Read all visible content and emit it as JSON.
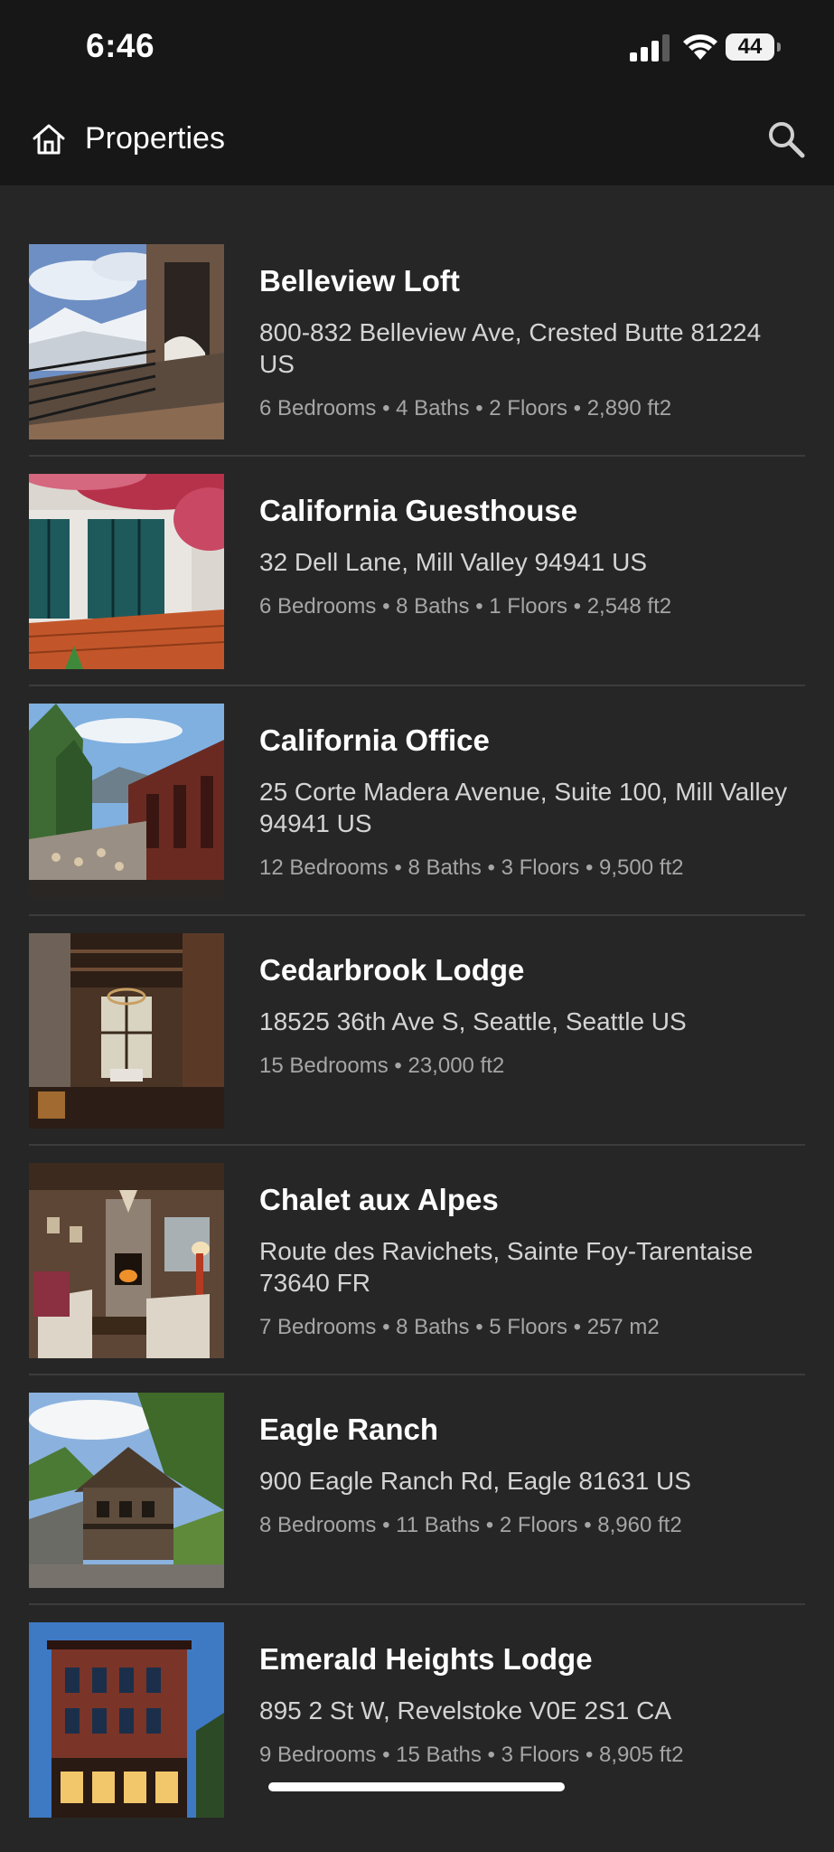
{
  "status_bar": {
    "time": "6:46",
    "battery": "44",
    "signal_icon": "cellular-signal-icon",
    "wifi_icon": "wifi-icon",
    "battery_icon": "battery-icon"
  },
  "app_bar": {
    "title": "Properties",
    "home_icon": "home-icon",
    "search_icon": "search-icon",
    "background": "#171717"
  },
  "colors": {
    "list_background": "#262626",
    "divider": "#3c3c3c",
    "name_text": "#ffffff",
    "address_text": "#d4d4d4",
    "meta_text": "#a6a6a6"
  },
  "properties": [
    {
      "name": "Belleview Loft",
      "address": "800-832 Belleview Ave, Crested Butte 81224 US",
      "details": "6 Bedrooms • 4 Baths • 2 Floors • 2,890 ft2"
    },
    {
      "name": "California Guesthouse",
      "address": "32 Dell Lane, Mill Valley 94941 US",
      "details": "6 Bedrooms • 8 Baths • 1 Floors • 2,548 ft2"
    },
    {
      "name": "California Office",
      "address": "25 Corte Madera Avenue, Suite 100, Mill Valley 94941 US",
      "details": "12 Bedrooms • 8 Baths • 3 Floors • 9,500 ft2"
    },
    {
      "name": "Cedarbrook Lodge",
      "address": "18525 36th Ave S, Seattle, Seattle US",
      "details": "15 Bedrooms • 23,000 ft2"
    },
    {
      "name": "Chalet aux Alpes",
      "address": "Route des Ravichets, Sainte Foy-Tarentaise 73640 FR",
      "details": "7 Bedrooms • 8 Baths • 5 Floors • 257 m2"
    },
    {
      "name": "Eagle Ranch",
      "address": "900 Eagle Ranch Rd, Eagle 81631 US",
      "details": "8 Bedrooms • 11 Baths • 2 Floors • 8,960 ft2"
    },
    {
      "name": "Emerald Heights Lodge",
      "address": "895 2 St W, Revelstoke V0E 2S1 CA",
      "details": "9 Bedrooms • 15 Baths • 3 Floors • 8,905 ft2"
    }
  ]
}
